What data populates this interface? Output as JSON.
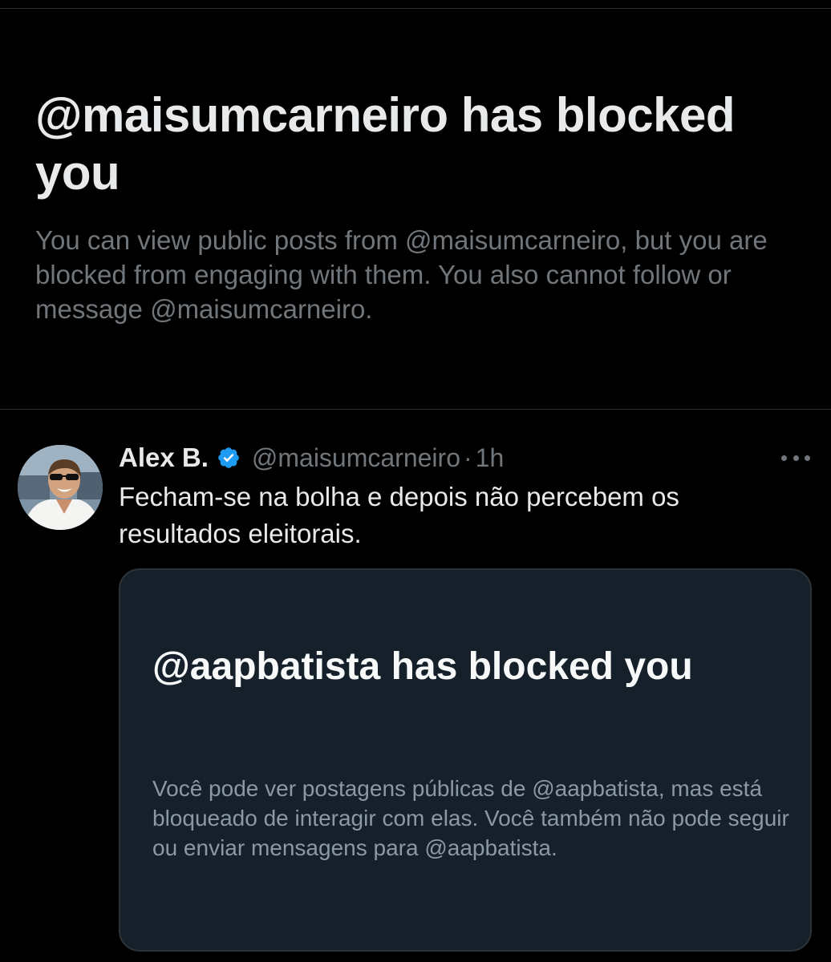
{
  "blocked_notice": {
    "title": "@maisumcarneiro has blocked you",
    "description": "You can view public posts from @maisumcarneiro, but you are blocked from engaging with them. You also cannot follow or message @maisumcarneiro."
  },
  "post": {
    "author_name": "Alex B.",
    "author_handle": "@maisumcarneiro",
    "separator": "·",
    "time": "1h",
    "verified": true,
    "text": "Fecham-se na bolha e depois não percebem os resultados eleitorais.",
    "icons": {
      "avatar": "user-avatar-photo",
      "verified": "verified-badge-icon",
      "more": "more-options-icon"
    },
    "quoted_image": {
      "title": "@aapbatista has blocked you",
      "description": "Você pode ver postagens públicas de @aapbatista, mas está bloqueado de interagir com elas. Você também não pode seguir ou enviar mensagens para @aapbatista."
    }
  },
  "colors": {
    "background": "#000000",
    "text_primary": "#e7e9ea",
    "text_secondary": "#71767b",
    "verified_blue": "#1d9bf0",
    "card_background": "#15202b",
    "card_text_secondary": "#8b98a5"
  }
}
